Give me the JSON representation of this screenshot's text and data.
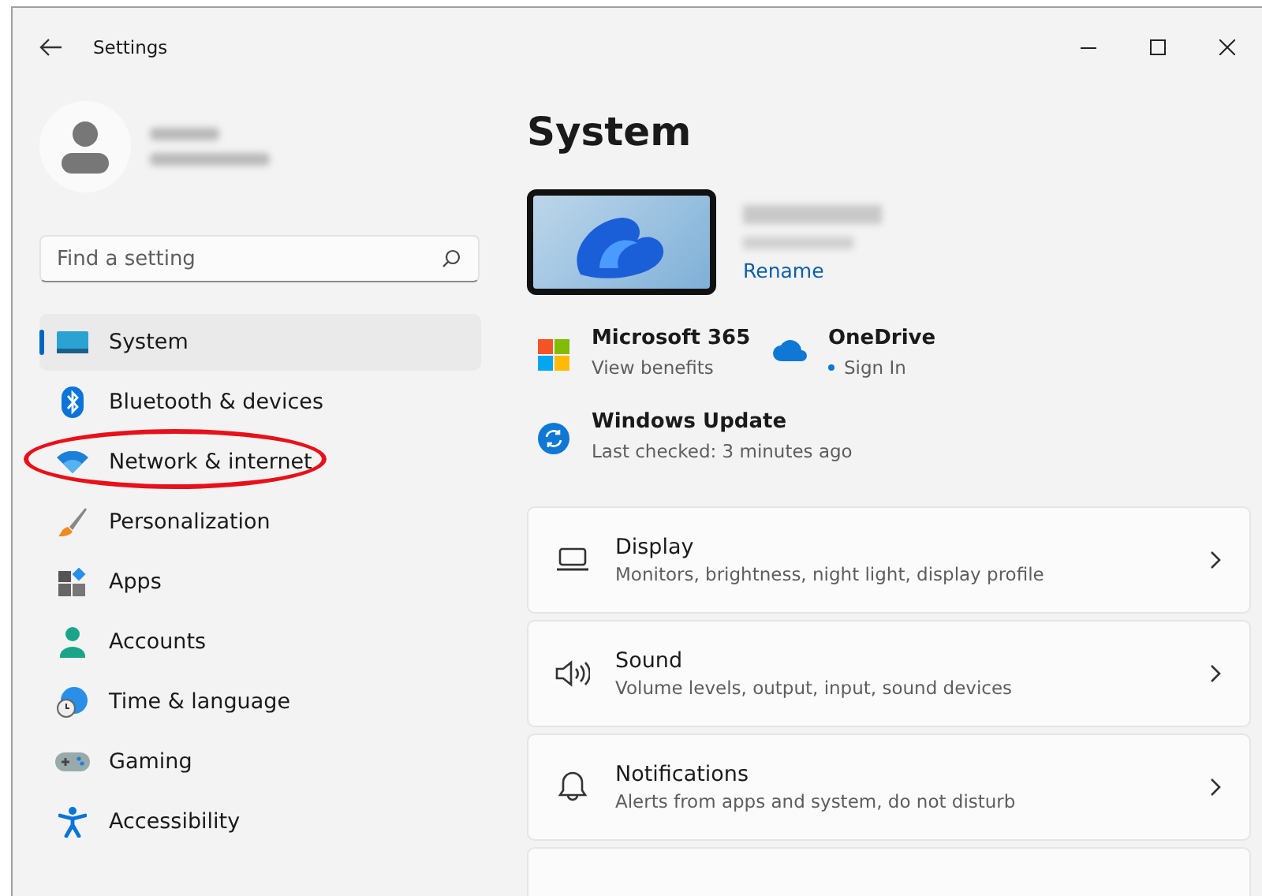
{
  "window": {
    "title": "Settings"
  },
  "search": {
    "placeholder": "Find a setting"
  },
  "nav": [
    {
      "label": "System",
      "selected": true,
      "circled": false
    },
    {
      "label": "Bluetooth & devices",
      "selected": false,
      "circled": false
    },
    {
      "label": "Network & internet",
      "selected": false,
      "circled": true
    },
    {
      "label": "Personalization",
      "selected": false,
      "circled": false
    },
    {
      "label": "Apps",
      "selected": false,
      "circled": false
    },
    {
      "label": "Accounts",
      "selected": false,
      "circled": false
    },
    {
      "label": "Time & language",
      "selected": false,
      "circled": false
    },
    {
      "label": "Gaming",
      "selected": false,
      "circled": false
    },
    {
      "label": "Accessibility",
      "selected": false,
      "circled": false
    }
  ],
  "page": {
    "title": "System",
    "rename_link": "Rename",
    "services": [
      {
        "title": "Microsoft 365",
        "subtitle": "View benefits"
      },
      {
        "title": "OneDrive",
        "subtitle": "Sign In"
      }
    ],
    "update": {
      "title": "Windows Update",
      "subtitle": "Last checked: 3 minutes ago"
    },
    "cards": [
      {
        "title": "Display",
        "subtitle": "Monitors, brightness, night light, display profile"
      },
      {
        "title": "Sound",
        "subtitle": "Volume levels, output, input, sound devices"
      },
      {
        "title": "Notifications",
        "subtitle": "Alerts from apps and system, do not disturb"
      }
    ]
  }
}
